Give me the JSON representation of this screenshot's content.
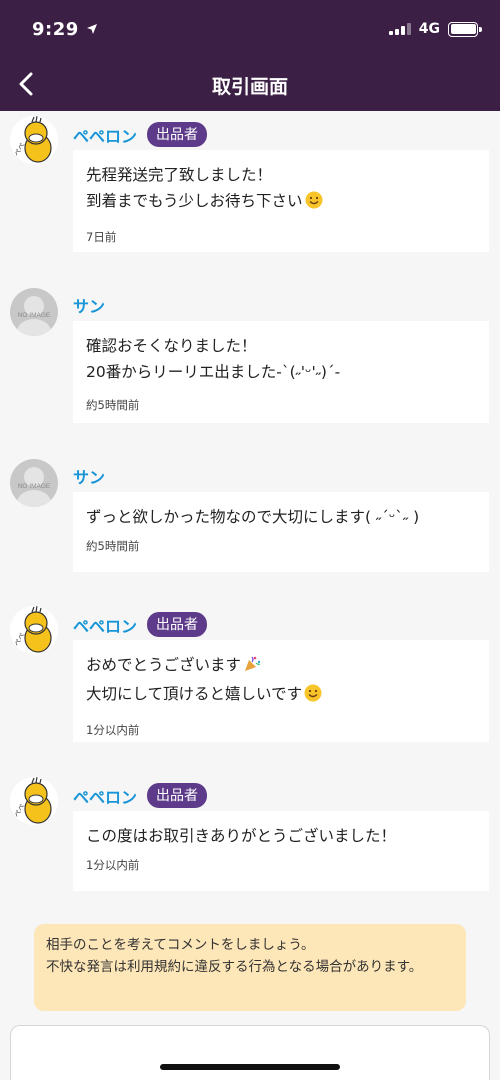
{
  "status_bar": {
    "time": "9:29",
    "network": "4G",
    "signal_icon": "signal-icon",
    "battery_icon": "battery-icon",
    "location_icon": "location-arrow-icon"
  },
  "header": {
    "title": "取引画面",
    "back_icon": "chevron-left-icon"
  },
  "messages": [
    {
      "sender": "ペペロン",
      "badge": "出品者",
      "text": "先程発送完了致しました！\n到着までもう少しお待ち下さい",
      "emoji": "smiling-face-emoji",
      "time": "7日前",
      "avatar": "psyduck-avatar"
    },
    {
      "sender": "サン",
      "badge": "",
      "text": "確認おそくなりました！\n20番からリーリエ出ました-`(˶'ᵕ'˶)´-",
      "time": "約5時間前",
      "avatar": "no-image-avatar",
      "avatar_label": "NO IMAGE"
    },
    {
      "sender": "サン",
      "badge": "",
      "text": "ずっと欲しかった物なので大切にします( ˶ˊᵕˋ˶ )",
      "time": "約5時間前",
      "avatar": "no-image-avatar",
      "avatar_label": "NO IMAGE"
    },
    {
      "sender": "ペペロン",
      "badge": "出品者",
      "text": "おめでとうございます\n大切にして頂けると嬉しいです",
      "emoji": "party-popper-and-smiling-face-emoji",
      "time": "1分以内前",
      "avatar": "psyduck-avatar"
    },
    {
      "sender": "ペペロン",
      "badge": "出品者",
      "text": "この度はお取引きありがとうございました！",
      "time": "1分以内前",
      "avatar": "psyduck-avatar"
    }
  ],
  "notice": {
    "text": "相手のことを考えてコメントをしましょう。\n不快な発言は利用規約に違反する行為となる場合があります。"
  },
  "colors": {
    "header_bg": "#3c1f44",
    "name": "#1795d6",
    "badge_bg": "#5e3b8a",
    "notice_bg": "#fde6b8",
    "page_bg": "#f7f6f6"
  }
}
